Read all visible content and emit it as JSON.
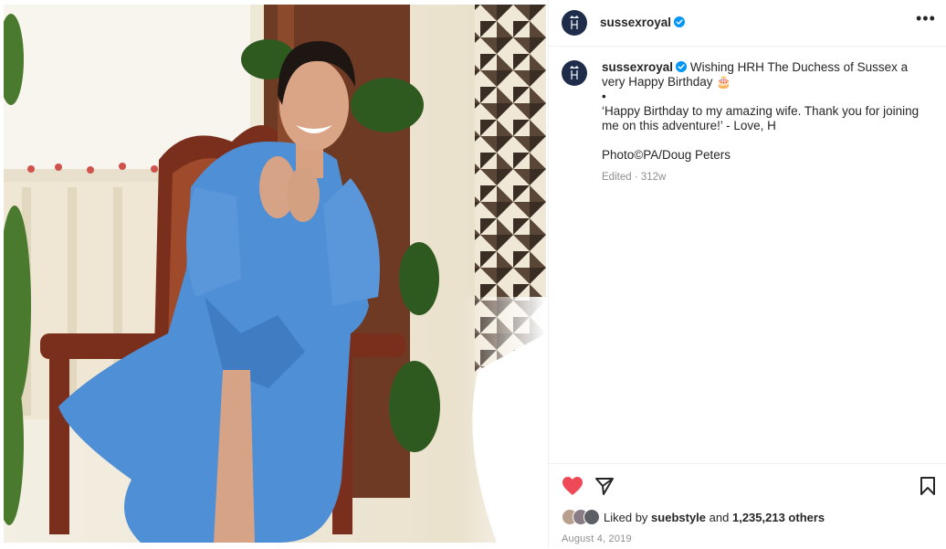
{
  "post": {
    "username": "sussexroyal",
    "more_icon": "more-horizontal-icon",
    "verified_icon": "verified-badge-icon",
    "photo_icon": "post-photo"
  },
  "caption": {
    "username": "sussexroyal",
    "line1": "Wishing HRH The Duchess of Sussex a very Happy Birthday 🎂",
    "bullet": "•",
    "quote": "‘Happy Birthday to my amazing wife. Thank you for joining me on this adventure!’ - Love, H",
    "credit": "Photo©PA/Doug Peters",
    "edited": "Edited",
    "separator": "·",
    "age": "312w"
  },
  "actions": {
    "like_icon": "heart-filled-icon",
    "like_color": "#ed4956",
    "share_icon": "send-icon",
    "save_icon": "bookmark-icon"
  },
  "likes": {
    "prefix": "Liked by",
    "user": "suebstyle",
    "joiner": "and",
    "count": "1,235,213 others"
  },
  "date": "August 4, 2019",
  "colors": {
    "accent_verified": "#0095f6",
    "avatar_bg": "#1f2d4a",
    "dress_blue": "#4f8fd6"
  }
}
